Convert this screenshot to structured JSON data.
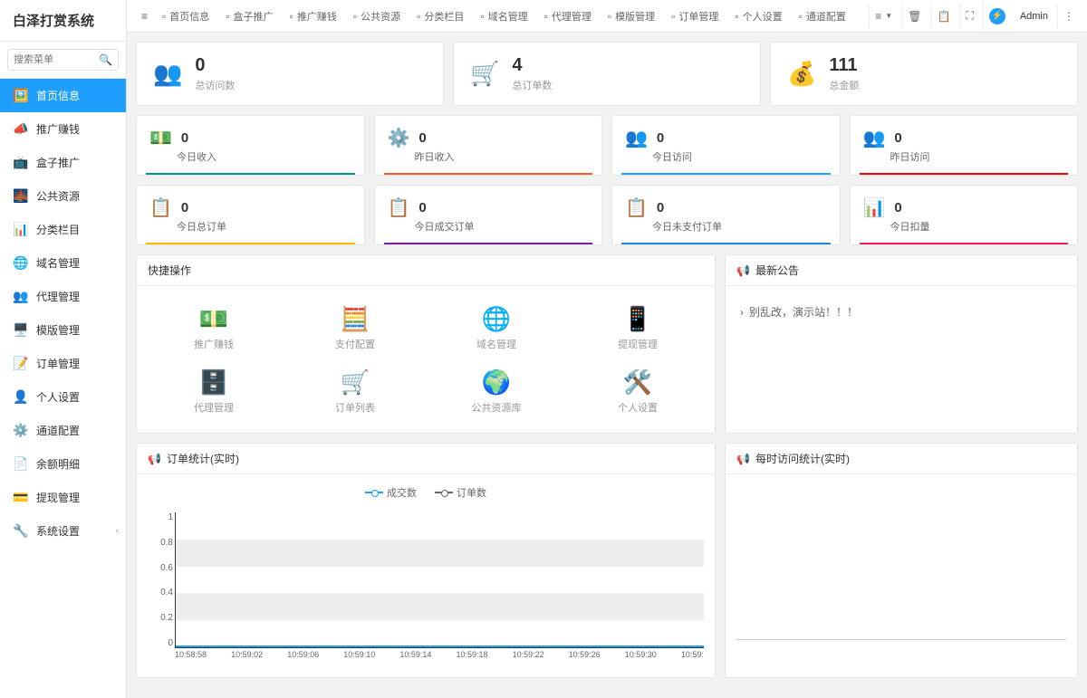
{
  "app_title": "白泽打赏系统",
  "search_placeholder": "搜索菜单",
  "admin_name": "Admin",
  "sidebar": {
    "items": [
      {
        "label": "首页信息",
        "icon": "🖼️",
        "active": true
      },
      {
        "label": "推广赚钱",
        "icon": "📣"
      },
      {
        "label": "盒子推广",
        "icon": "📺"
      },
      {
        "label": "公共资源",
        "icon": "🌉"
      },
      {
        "label": "分类栏目",
        "icon": "📊"
      },
      {
        "label": "域名管理",
        "icon": "🌐"
      },
      {
        "label": "代理管理",
        "icon": "👥"
      },
      {
        "label": "模版管理",
        "icon": "🖥️"
      },
      {
        "label": "订单管理",
        "icon": "📝"
      },
      {
        "label": "个人设置",
        "icon": "👤"
      },
      {
        "label": "通道配置",
        "icon": "⚙️"
      },
      {
        "label": "余额明细",
        "icon": "📄"
      },
      {
        "label": "提现管理",
        "icon": "💳"
      },
      {
        "label": "系统设置",
        "icon": "🔧",
        "chevron": true
      }
    ]
  },
  "top_tabs": [
    {
      "label": "首页信息"
    },
    {
      "label": "盒子推广"
    },
    {
      "label": "推广赚钱"
    },
    {
      "label": "公共资源"
    },
    {
      "label": "分类栏目"
    },
    {
      "label": "域名管理"
    },
    {
      "label": "代理管理"
    },
    {
      "label": "模版管理"
    },
    {
      "label": "订单管理"
    },
    {
      "label": "个人设置"
    },
    {
      "label": "通道配置"
    }
  ],
  "top_stats": [
    {
      "value": "0",
      "label": "总访问数",
      "icon": "👥"
    },
    {
      "value": "4",
      "label": "总订单数",
      "icon": "🛒"
    },
    {
      "value": "111",
      "label": "总金额",
      "icon": "💰"
    }
  ],
  "mini_stats_row1": [
    {
      "value": "0",
      "label": "今日收入",
      "icon": "💵",
      "color": "#009688"
    },
    {
      "value": "0",
      "label": "昨日收入",
      "icon": "⚙️",
      "color": "#ff5722"
    },
    {
      "value": "0",
      "label": "今日访问",
      "icon": "👥",
      "color": "#1e9fff"
    },
    {
      "value": "0",
      "label": "昨日访问",
      "icon": "👥",
      "color": "#ff0000"
    }
  ],
  "mini_stats_row2": [
    {
      "value": "0",
      "label": "今日总订单",
      "icon": "📋",
      "color": "#ffb800"
    },
    {
      "value": "0",
      "label": "今日成交订单",
      "icon": "📋",
      "color": "#7b1fa2"
    },
    {
      "value": "0",
      "label": "今日未支付订单",
      "icon": "📋",
      "color": "#1e88e5"
    },
    {
      "value": "0",
      "label": "今日扣量",
      "icon": "📊",
      "color": "#e91e63"
    }
  ],
  "quick_ops": {
    "title": "快捷操作",
    "items": [
      {
        "label": "推广赚钱",
        "icon": "💵"
      },
      {
        "label": "支付配置",
        "icon": "🧮"
      },
      {
        "label": "域名管理",
        "icon": "🌐"
      },
      {
        "label": "提现管理",
        "icon": "📱"
      },
      {
        "label": "代理管理",
        "icon": "🗄️"
      },
      {
        "label": "订单列表",
        "icon": "🛒"
      },
      {
        "label": "公共资源库",
        "icon": "🌍"
      },
      {
        "label": "个人设置",
        "icon": "🛠️"
      }
    ]
  },
  "announce": {
    "title": "最新公告",
    "items": [
      "别乱改，演示站！！！"
    ]
  },
  "chart": {
    "title": "订单统计(实时)",
    "right_title": "每时访问统计(实时)",
    "legend": [
      "成交数",
      "订单数"
    ]
  },
  "chart_data": {
    "type": "line",
    "title": "订单统计(实时)",
    "xlabel": "",
    "ylabel": "",
    "ylim": [
      0,
      1
    ],
    "y_ticks": [
      0,
      0.2,
      0.4,
      0.6,
      0.8,
      1
    ],
    "categories": [
      "10:58:58",
      "10:59:02",
      "10:59:06",
      "10:59:10",
      "10:59:14",
      "10:59:18",
      "10:59:22",
      "10:59:26",
      "10:59:30",
      "10:59:"
    ],
    "series": [
      {
        "name": "成交数",
        "color": "#1e9fff",
        "values": [
          0,
          0,
          0,
          0,
          0,
          0,
          0,
          0,
          0,
          0
        ]
      },
      {
        "name": "订单数",
        "color": "#666",
        "values": [
          0,
          0,
          0,
          0,
          0,
          0,
          0,
          0,
          0,
          0
        ]
      }
    ]
  }
}
